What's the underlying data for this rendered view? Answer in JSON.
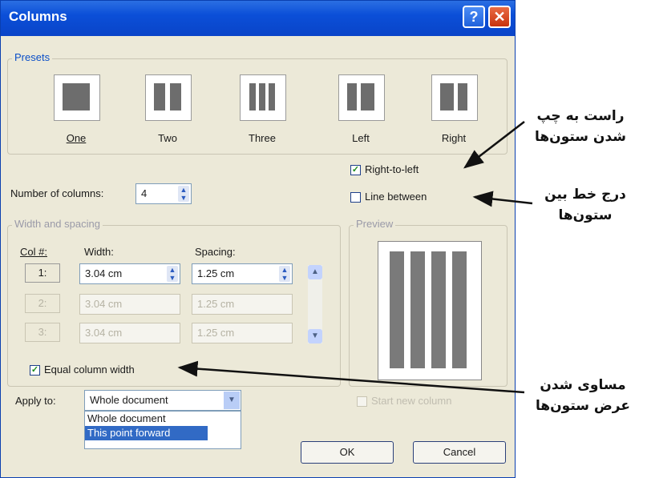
{
  "dialog": {
    "title": "Columns"
  },
  "presets": {
    "label": "Presets",
    "items": [
      {
        "label": "One"
      },
      {
        "label": "Two"
      },
      {
        "label": "Three"
      },
      {
        "label": "Left"
      },
      {
        "label": "Right"
      }
    ]
  },
  "number_of_columns": {
    "label": "Number of columns:",
    "value": "4"
  },
  "options": {
    "right_to_left": {
      "label": "Right-to-left",
      "checked": true
    },
    "line_between": {
      "label": "Line between",
      "checked": false
    },
    "equal_width": {
      "label": "Equal column width",
      "checked": true
    },
    "start_new": {
      "label": "Start new column",
      "checked": false
    }
  },
  "width_spacing": {
    "label": "Width and spacing",
    "headers": {
      "col": "Col #:",
      "width": "Width:",
      "spacing": "Spacing:"
    },
    "rows": [
      {
        "col": "1:",
        "width": "3.04 cm",
        "spacing": "1.25 cm"
      },
      {
        "col": "2:",
        "width": "3.04 cm",
        "spacing": "1.25 cm"
      },
      {
        "col": "3:",
        "width": "3.04 cm",
        "spacing": "1.25 cm"
      }
    ]
  },
  "preview": {
    "label": "Preview"
  },
  "apply_to": {
    "label": "Apply to:",
    "value": "Whole document",
    "options": [
      "Whole document",
      "This point forward"
    ]
  },
  "buttons": {
    "ok": "OK",
    "cancel": "Cancel"
  },
  "annotations": {
    "rtl": [
      "راست به چپ",
      "شدن ستون‌ها"
    ],
    "line": [
      "درج خط بین",
      "ستون‌ها"
    ],
    "equal": [
      "مساوی شدن",
      "عرض ستون‌ها"
    ]
  }
}
